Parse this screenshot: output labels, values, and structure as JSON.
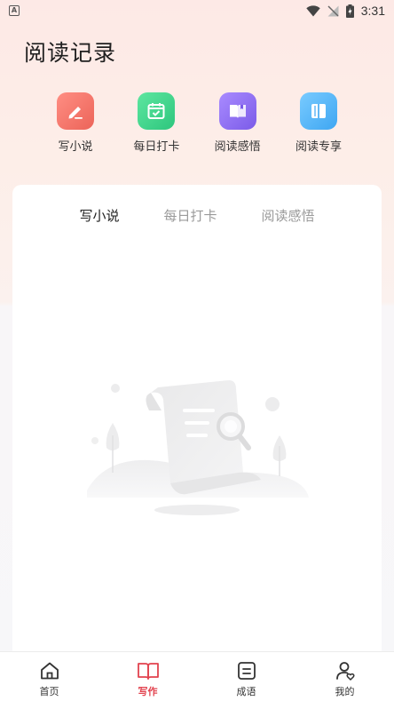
{
  "status_bar": {
    "app_badge": "A",
    "time": "3:31",
    "icons": [
      "wifi-icon",
      "no-signal-icon",
      "battery-charging-icon"
    ]
  },
  "page": {
    "title": "阅读记录"
  },
  "shortcuts": [
    {
      "label": "写小说",
      "icon": "pen-icon",
      "color": "#f27a6e"
    },
    {
      "label": "每日打卡",
      "icon": "calendar-check-icon",
      "color": "#3ed18a"
    },
    {
      "label": "阅读感悟",
      "icon": "open-book-icon",
      "color": "#8c6cf0"
    },
    {
      "label": "阅读专享",
      "icon": "book-icon",
      "color": "#4fb4f6"
    }
  ],
  "tabs": [
    {
      "label": "写小说",
      "active": true
    },
    {
      "label": "每日打卡",
      "active": false
    },
    {
      "label": "阅读感悟",
      "active": false
    }
  ],
  "empty_state": {
    "icon": "empty-document-search-icon"
  },
  "bottom_nav": [
    {
      "label": "首页",
      "icon": "home-icon",
      "active": false
    },
    {
      "label": "写作",
      "icon": "book-icon",
      "active": true
    },
    {
      "label": "成语",
      "icon": "list-box-icon",
      "active": false
    },
    {
      "label": "我的",
      "icon": "user-heart-icon",
      "active": false
    }
  ],
  "colors": {
    "accent": "#e2434f",
    "header_gradient_top": "#fde9e6",
    "card": "#ffffff"
  }
}
